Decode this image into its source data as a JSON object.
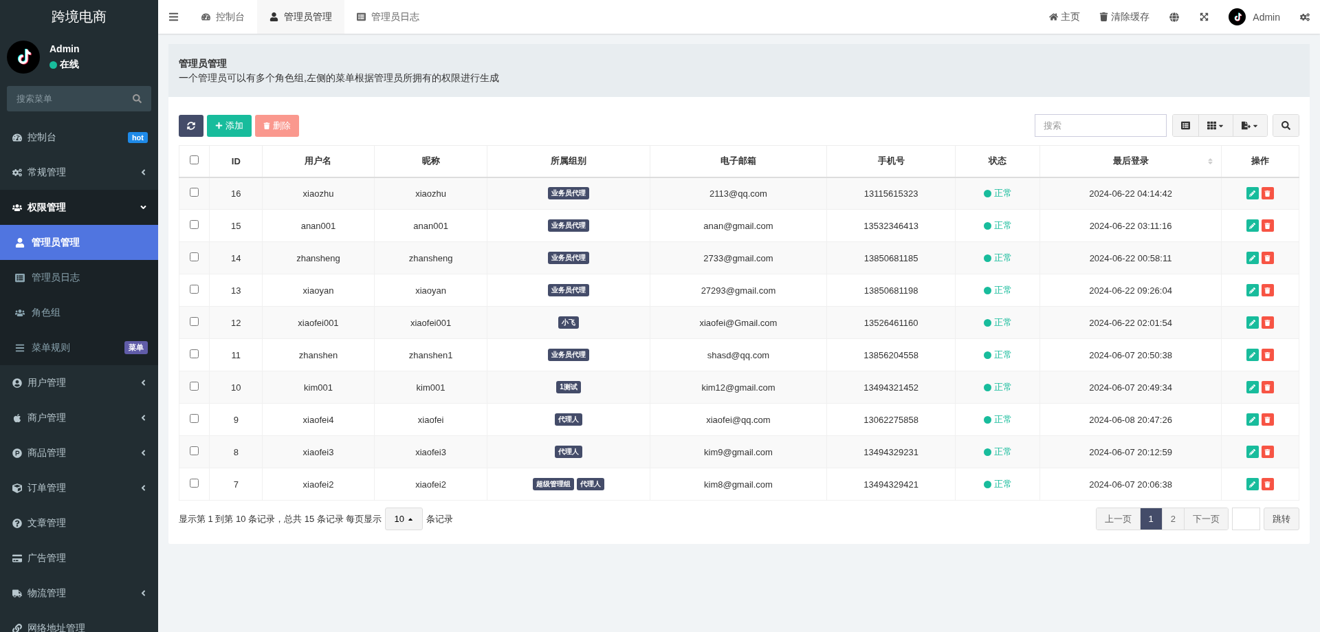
{
  "sidebar": {
    "brand": "跨境电商",
    "user": {
      "name": "Admin",
      "status": "在线"
    },
    "search": {
      "placeholder": "搜索菜单"
    },
    "menu": [
      {
        "label": "控制台",
        "kind": "link",
        "badge": {
          "text": "hot",
          "color": "#1e8ae8"
        }
      },
      {
        "label": "常规管理",
        "kind": "group",
        "expanded": false
      },
      {
        "label": "权限管理",
        "kind": "group",
        "expanded": true,
        "children": [
          {
            "label": "管理员管理",
            "selected": true
          },
          {
            "label": "管理员日志",
            "selected": false
          },
          {
            "label": "角色组",
            "selected": false
          },
          {
            "label": "菜单规则",
            "selected": false,
            "badge": {
              "text": "菜单",
              "color": "#605ca8"
            }
          }
        ]
      },
      {
        "label": "用户管理",
        "kind": "group",
        "expanded": false
      },
      {
        "label": "商户管理",
        "kind": "group",
        "expanded": false
      },
      {
        "label": "商品管理",
        "kind": "group",
        "expanded": false
      },
      {
        "label": "订单管理",
        "kind": "group",
        "expanded": false
      },
      {
        "label": "文章管理",
        "kind": "link"
      },
      {
        "label": "广告管理",
        "kind": "link"
      },
      {
        "label": "物流管理",
        "kind": "group",
        "expanded": false
      },
      {
        "label": "网络地址管理",
        "kind": "link"
      }
    ]
  },
  "topbar": {
    "tabs": [
      {
        "label": "控制台",
        "selected": false
      },
      {
        "label": "管理员管理",
        "selected": true
      },
      {
        "label": "管理员日志",
        "selected": false
      }
    ],
    "links": [
      "主页",
      "清除缓存"
    ],
    "user": "Admin"
  },
  "panel": {
    "title": "管理员管理",
    "description": "一个管理员可以有多个角色组,左侧的菜单根据管理员所拥有的权限进行生成",
    "buttons": {
      "add": "添加",
      "delete": "删除",
      "delete_disabled": true
    },
    "search": {
      "placeholder": "搜索"
    },
    "select_all_checked": false,
    "columns": [
      "ID",
      "用户名",
      "昵称",
      "所属组别",
      "电子邮箱",
      "手机号",
      "状态",
      "最后登录",
      "操作"
    ],
    "rows": [
      {
        "id": "16",
        "username": "xiaozhu",
        "nickname": "xiaozhu",
        "groups": [
          "业务员代理"
        ],
        "email": "2113@qq.com",
        "mobile": "13115615323",
        "status": "正常",
        "last_login": "2024-06-22 04:14:42",
        "checked": false
      },
      {
        "id": "15",
        "username": "anan001",
        "nickname": "anan001",
        "groups": [
          "业务员代理"
        ],
        "email": "anan@gmail.com",
        "mobile": "13532346413",
        "status": "正常",
        "last_login": "2024-06-22 03:11:16",
        "checked": false
      },
      {
        "id": "14",
        "username": "zhansheng",
        "nickname": "zhansheng",
        "groups": [
          "业务员代理"
        ],
        "email": "2733@gmail.com",
        "mobile": "13850681185",
        "status": "正常",
        "last_login": "2024-06-22 00:58:11",
        "checked": false
      },
      {
        "id": "13",
        "username": "xiaoyan",
        "nickname": "xiaoyan",
        "groups": [
          "业务员代理"
        ],
        "email": "27293@gmail.com",
        "mobile": "13850681198",
        "status": "正常",
        "last_login": "2024-06-22 09:26:04",
        "checked": false
      },
      {
        "id": "12",
        "username": "xiaofei001",
        "nickname": "xiaofei001",
        "groups": [
          "小飞"
        ],
        "email": "xiaofei@Gmail.com",
        "mobile": "13526461160",
        "status": "正常",
        "last_login": "2024-06-22 02:01:54",
        "checked": false
      },
      {
        "id": "11",
        "username": "zhanshen",
        "nickname": "zhanshen1",
        "groups": [
          "业务员代理"
        ],
        "email": "shasd@qq.com",
        "mobile": "13856204558",
        "status": "正常",
        "last_login": "2024-06-07 20:50:38",
        "checked": false
      },
      {
        "id": "10",
        "username": "kim001",
        "nickname": "kim001",
        "groups": [
          "1测试"
        ],
        "email": "kim12@gmail.com",
        "mobile": "13494321452",
        "status": "正常",
        "last_login": "2024-06-07 20:49:34",
        "checked": false
      },
      {
        "id": "9",
        "username": "xiaofei4",
        "nickname": "xiaofei",
        "groups": [
          "代理人"
        ],
        "email": "xiaofei@qq.com",
        "mobile": "13062275858",
        "status": "正常",
        "last_login": "2024-06-08 20:47:26",
        "checked": false
      },
      {
        "id": "8",
        "username": "xiaofei3",
        "nickname": "xiaofei3",
        "groups": [
          "代理人"
        ],
        "email": "kim9@gmail.com",
        "mobile": "13494329231",
        "status": "正常",
        "last_login": "2024-06-07 20:12:59",
        "checked": false
      },
      {
        "id": "7",
        "username": "xiaofei2",
        "nickname": "xiaofei2",
        "groups": [
          "超级管理组",
          "代理人"
        ],
        "email": "kim8@gmail.com",
        "mobile": "13494329421",
        "status": "正常",
        "last_login": "2024-06-07 20:06:38",
        "checked": false
      }
    ],
    "pagination": {
      "summary": "显示第 1 到第 10 条记录，总共 15 条记录 每页显示",
      "page_size": "10",
      "suffix": "条记录",
      "prev": "上一页",
      "pages": [
        {
          "label": "1",
          "selected": true
        },
        {
          "label": "2",
          "selected": false
        }
      ],
      "next": "下一页",
      "jump": "跳转"
    }
  }
}
